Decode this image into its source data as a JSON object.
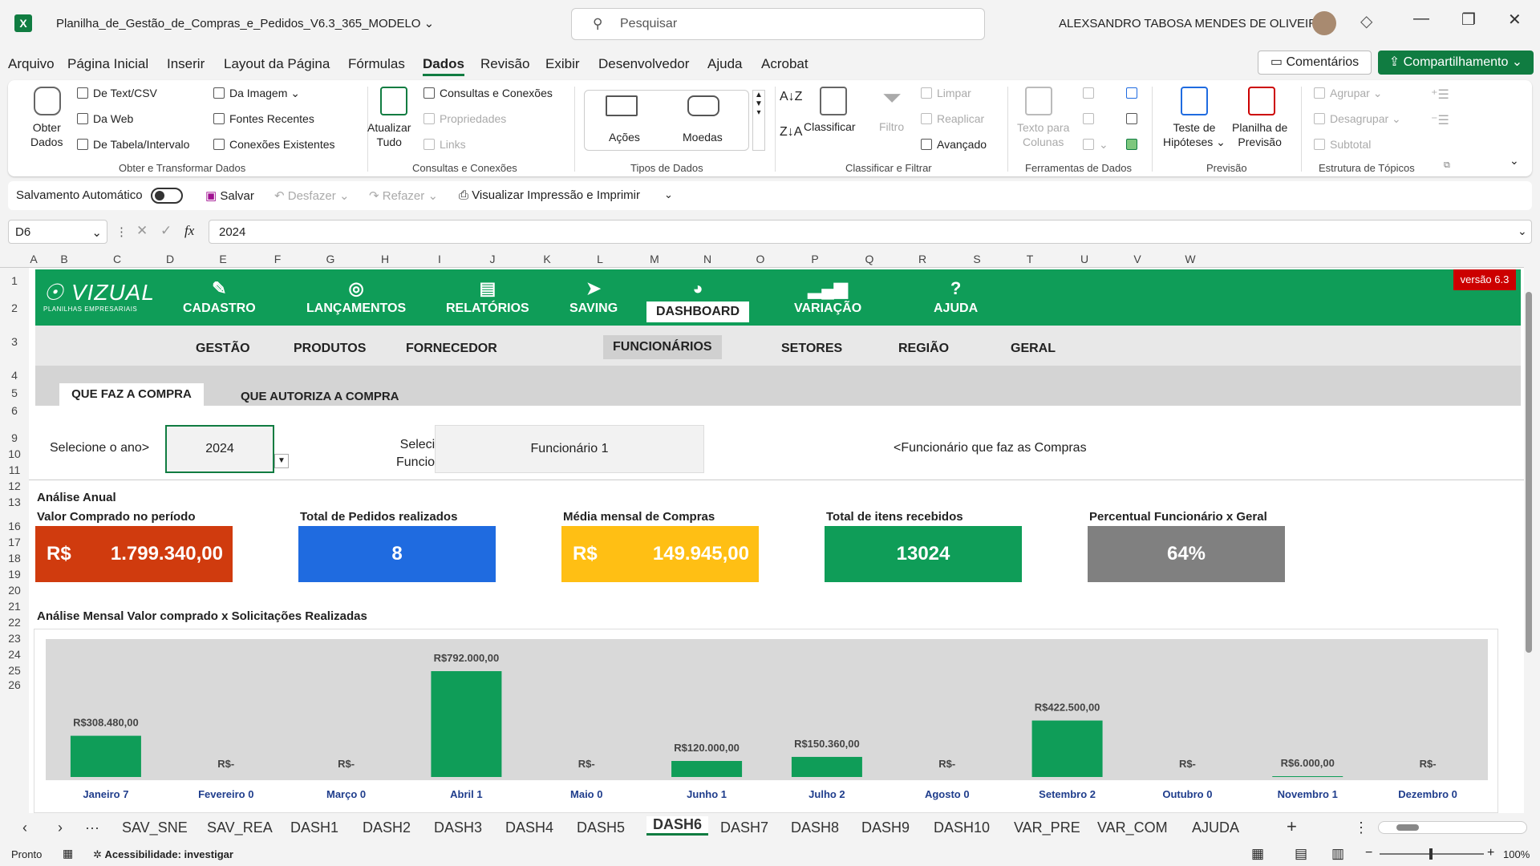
{
  "titlebar": {
    "file_title": "Planilha_de_Gestão_de_Compras_e_Pedidos_V6.3_365_MODELO",
    "search_placeholder": "Pesquisar",
    "user_name": "ALEXSANDRO TABOSA MENDES DE OLIVEIRA"
  },
  "menu": [
    "Arquivo",
    "Página Inicial",
    "Inserir",
    "Layout da Página",
    "Fórmulas",
    "Dados",
    "Revisão",
    "Exibir",
    "Desenvolvedor",
    "Ajuda",
    "Acrobat"
  ],
  "menu_right": {
    "comments": "Comentários",
    "share": "Compartilhamento"
  },
  "ribbon": {
    "obter_dados": "Obter\nDados",
    "de_text_csv": "De Text/CSV",
    "da_web": "Da Web",
    "de_tabela": "De Tabela/Intervalo",
    "da_imagem": "Da Imagem",
    "fontes_recentes": "Fontes Recentes",
    "conexoes_existentes": "Conexões Existentes",
    "group1": "Obter e Transformar Dados",
    "atualizar_tudo": "Atualizar\nTudo",
    "consultas_conexoes": "Consultas e Conexões",
    "propriedades": "Propriedades",
    "links": "Links",
    "group2": "Consultas e Conexões",
    "acoes": "Ações",
    "moedas": "Moedas",
    "group3": "Tipos de Dados",
    "classificar": "Classificar",
    "filtro": "Filtro",
    "limpar": "Limpar",
    "reaplicar": "Reaplicar",
    "avancado": "Avançado",
    "group4": "Classificar e Filtrar",
    "texto_colunas": "Texto para\nColunas",
    "group5": "Ferramentas de Dados",
    "teste_hipoteses": "Teste de\nHipóteses",
    "planilha_previsao": "Planilha de\nPrevisão",
    "group6": "Previsão",
    "agrupar": "Agrupar",
    "desagrupar": "Desagrupar",
    "subtotal": "Subtotal",
    "group7": "Estrutura de Tópicos"
  },
  "qat": {
    "autosave": "Salvamento Automático",
    "save": "Salvar",
    "undo": "Desfazer",
    "redo": "Refazer",
    "print": "Visualizar Impressão e Imprimir"
  },
  "formula": {
    "namebox": "D6",
    "value": "2024"
  },
  "columns": [
    "A",
    "B",
    "C",
    "D",
    "E",
    "F",
    "G",
    "H",
    "I",
    "J",
    "K",
    "L",
    "M",
    "N",
    "O",
    "P",
    "Q",
    "R",
    "S",
    "T",
    "U",
    "V",
    "W"
  ],
  "rows": [
    "1",
    "2",
    "3",
    "4",
    "5",
    "6",
    "9",
    "10",
    "11",
    "12",
    "13",
    "16",
    "17",
    "18",
    "19",
    "20",
    "21",
    "22",
    "23",
    "24",
    "25",
    "26"
  ],
  "nav": {
    "logo_big": "VIZUAL",
    "logo_small": "PLANILHAS EMPRESARIAIS",
    "items": [
      "CADASTRO",
      "LANÇAMENTOS",
      "RELATÓRIOS",
      "SAVING",
      "DASHBOARD",
      "VARIAÇÃO",
      "AJUDA"
    ],
    "version": "versão 6.3"
  },
  "subnav": [
    "GESTÃO",
    "PRODUTOS",
    "FORNECEDOR",
    "FUNCIONÁRIOS",
    "SETORES",
    "REGIÃO",
    "GERAL"
  ],
  "subnav2": {
    "tab1": "QUE FAZ A COMPRA",
    "tab2": "QUE AUTORIZA A COMPRA"
  },
  "filters": {
    "year_label": "Selecione o ano>",
    "year_value": "2024",
    "func_label_1": "Selecione o",
    "func_label_2": "Funcionário>",
    "func_value": "Funcionário 1",
    "func_note": "<Funcionário que faz as Compras"
  },
  "annual": {
    "section_title": "Análise Anual",
    "k1_title": "Valor Comprado no período",
    "k1_cur": "R$",
    "k1_val": "1.799.340,00",
    "k2_title": "Total de Pedidos realizados",
    "k2_val": "8",
    "k3_title": "Média mensal de Compras",
    "k3_cur": "R$",
    "k3_val": "149.945,00",
    "k4_title": "Total de itens recebidos",
    "k4_val": "13024",
    "k5_title": "Percentual Funcionário x Geral",
    "k5_val": "64%"
  },
  "chart_title": "Análise Mensal Valor comprado x Solicitações Realizadas",
  "chart_data": {
    "type": "bar",
    "categories": [
      "Janeiro",
      "Fevereiro",
      "Março",
      "Abril",
      "Maio",
      "Junho",
      "Julho",
      "Agosto",
      "Setembro",
      "Outubro",
      "Novembro",
      "Dezembro"
    ],
    "counts": [
      7,
      0,
      0,
      1,
      0,
      1,
      2,
      0,
      2,
      0,
      1,
      0
    ],
    "values": [
      308480,
      0,
      0,
      792000,
      0,
      120000,
      150360,
      0,
      422500,
      0,
      6000,
      0
    ],
    "labels": [
      "R$308.480,00",
      "R$-",
      "R$-",
      "R$792.000,00",
      "R$-",
      "R$120.000,00",
      "R$150.360,00",
      "R$-",
      "R$422.500,00",
      "R$-",
      "R$6.000,00",
      "R$-"
    ],
    "ylim": [
      0,
      792000
    ],
    "bar_color": "#0f9d58"
  },
  "sheets": [
    "SAV_SNE",
    "SAV_REA",
    "DASH1",
    "DASH2",
    "DASH3",
    "DASH4",
    "DASH5",
    "DASH6",
    "DASH7",
    "DASH8",
    "DASH9",
    "DASH10",
    "VAR_PRE",
    "VAR_COM",
    "AJUDA"
  ],
  "active_sheet": "DASH6",
  "status": {
    "ready": "Pronto",
    "accessibility": "Acessibilidade: investigar",
    "zoom": "100%"
  }
}
